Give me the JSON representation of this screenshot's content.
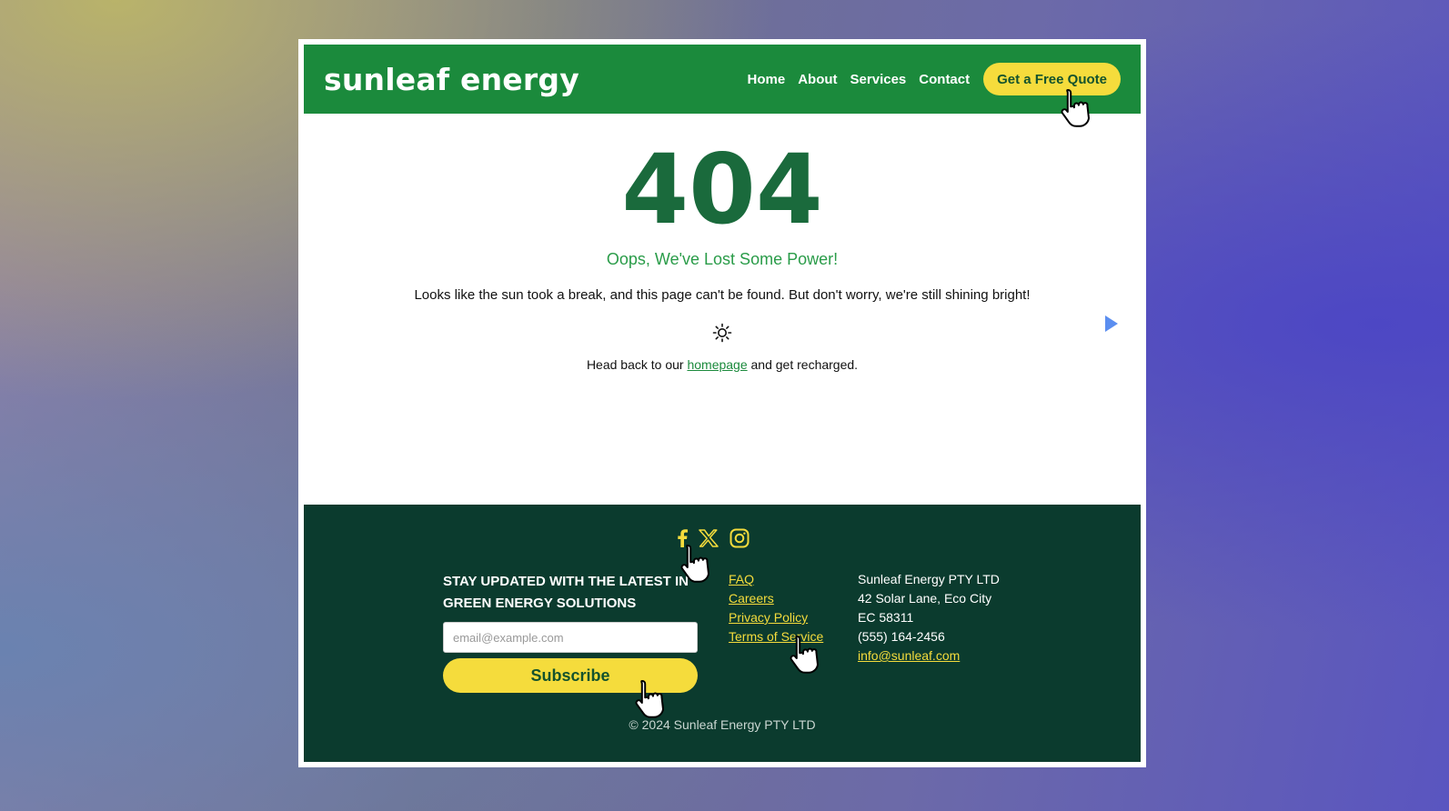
{
  "header": {
    "logo": "sunleaf energy",
    "nav": [
      "Home",
      "About",
      "Services",
      "Contact"
    ],
    "cta": "Get a Free Quote"
  },
  "error": {
    "code": "404",
    "title": "Oops, We've Lost Some Power!",
    "message": "Looks like the sun took a break, and this page can't be found. But don't worry, we're still shining bright!",
    "back_prefix": "Head back to our ",
    "back_link": "homepage",
    "back_suffix": " and get recharged."
  },
  "footer": {
    "newsletter_title_line1": "STAY UPDATED WITH THE LATEST IN",
    "newsletter_title_line2": "GREEN ENERGY SOLUTIONS",
    "email_placeholder": "email@example.com",
    "subscribe_label": "Subscribe",
    "links": [
      "FAQ",
      "Careers",
      "Privacy Policy",
      "Terms of Service"
    ],
    "company": "Sunleaf Energy PTY LTD",
    "street": "42 Solar Lane, Eco City",
    "postcode": "EC 58311",
    "phone": "(555) 164-2456",
    "email": "info@sunleaf.com",
    "copyright": "© 2024 Sunleaf Energy PTY LTD"
  },
  "colors": {
    "brand_green": "#1b8a3c",
    "footer_green": "#0b3b2e",
    "accent_yellow": "#f5dc3c"
  },
  "icons": [
    "sun-icon",
    "facebook-icon",
    "x-icon",
    "instagram-icon",
    "play-icon",
    "hand-cursor-icon"
  ]
}
